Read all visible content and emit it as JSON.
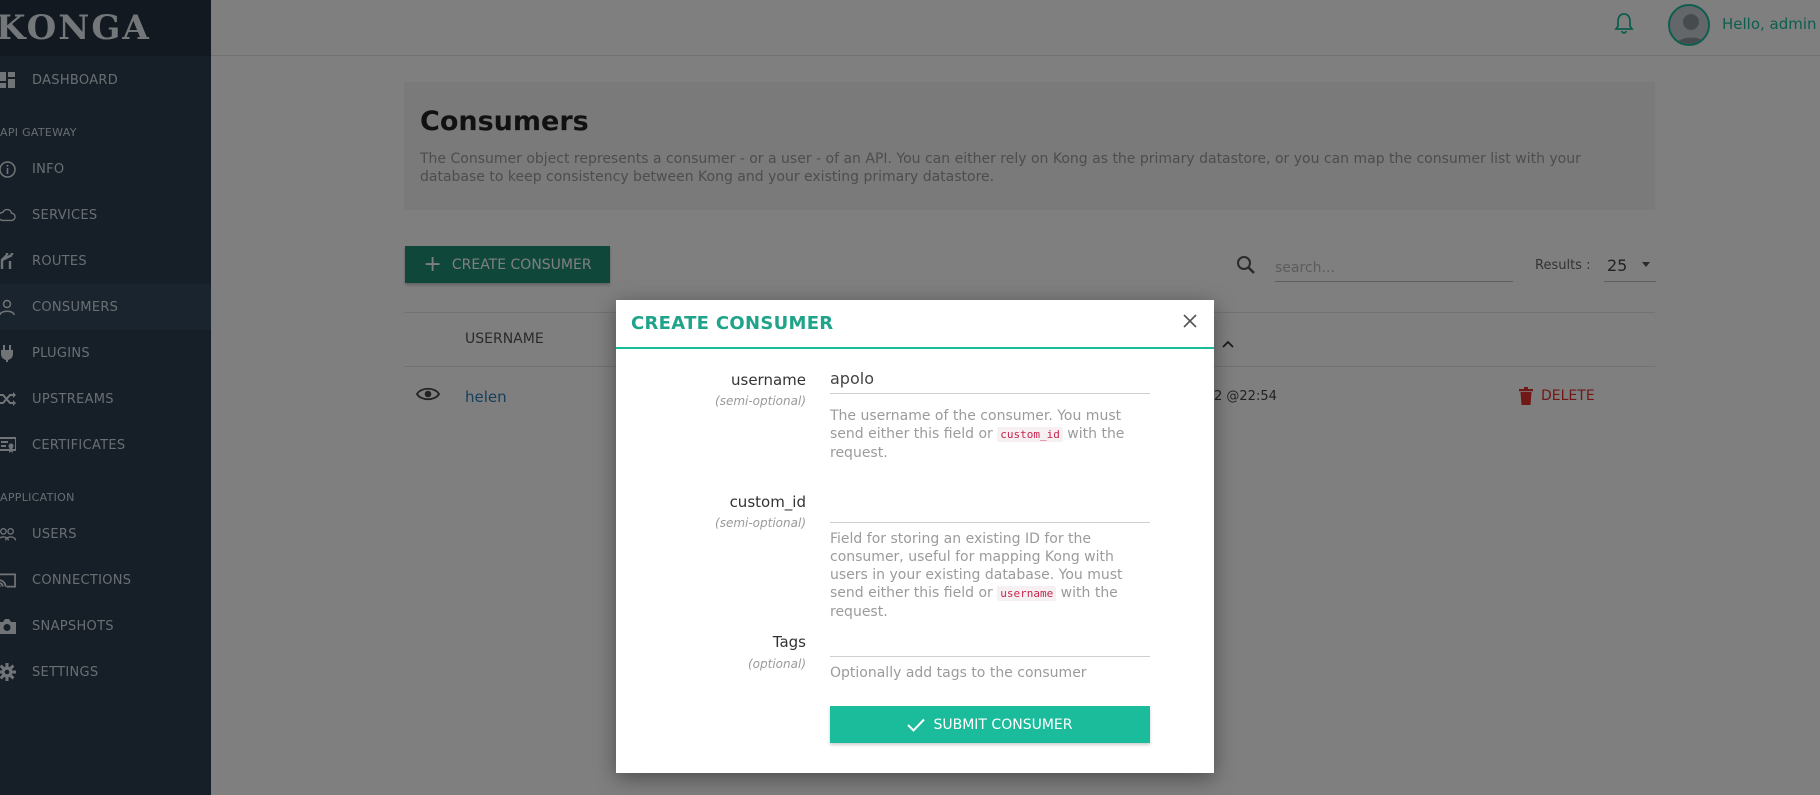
{
  "app": {
    "logo": "KONGA",
    "user_greeting": "Hello, admin"
  },
  "sidebar": {
    "sections": {
      "api_gateway": "API GATEWAY",
      "application": "APPLICATION"
    },
    "items": [
      {
        "label": "DASHBOARD",
        "icon": "dashboard-icon"
      },
      {
        "label": "INFO",
        "icon": "info-icon"
      },
      {
        "label": "SERVICES",
        "icon": "cloud-icon"
      },
      {
        "label": "ROUTES",
        "icon": "routes-icon"
      },
      {
        "label": "CONSUMERS",
        "icon": "user-icon",
        "active": true
      },
      {
        "label": "PLUGINS",
        "icon": "plug-icon"
      },
      {
        "label": "UPSTREAMS",
        "icon": "shuffle-icon"
      },
      {
        "label": "CERTIFICATES",
        "icon": "certificate-icon"
      },
      {
        "label": "USERS",
        "icon": "users-icon"
      },
      {
        "label": "CONNECTIONS",
        "icon": "cast-icon"
      },
      {
        "label": "SNAPSHOTS",
        "icon": "camera-icon"
      },
      {
        "label": "SETTINGS",
        "icon": "gear-icon"
      }
    ]
  },
  "page": {
    "title": "Consumers",
    "description": "The Consumer object represents a consumer - or a user - of an API. You can either rely on Kong as the primary datastore, or you can map the consumer list with your database to keep consistency between Kong and your existing primary datastore.",
    "create_button": "CREATE CONSUMER",
    "search_placeholder": "search...",
    "results_label": "Results :",
    "results_value": "25"
  },
  "table": {
    "columns": [
      "USERNAME"
    ],
    "rows": [
      {
        "username": "helen",
        "created_partial": "2 @22:54",
        "action": "DELETE"
      }
    ]
  },
  "modal": {
    "title": "CREATE CONSUMER",
    "fields": {
      "username": {
        "label": "username",
        "hint": "(semi-optional)",
        "value": "apolo",
        "help_before": "The username of the consumer. You must send either this field or",
        "help_code": "custom_id",
        "help_after": "with the request."
      },
      "custom_id": {
        "label": "custom_id",
        "hint": "(semi-optional)",
        "value": "",
        "help_before": "Field for storing an existing ID for the consumer, useful for mapping Kong with users in your existing database. You must send either this field or",
        "help_code": "username",
        "help_after": "with the request."
      },
      "tags": {
        "label": "Tags",
        "hint": "(optional)",
        "value": "",
        "help": "Optionally add tags to the consumer"
      }
    },
    "submit_label": "SUBMIT CONSUMER"
  },
  "colors": {
    "accent": "#1abc9c",
    "sidebar_bg": "#2c3e50",
    "danger": "#e0302d",
    "link": "#2c7fb8"
  }
}
